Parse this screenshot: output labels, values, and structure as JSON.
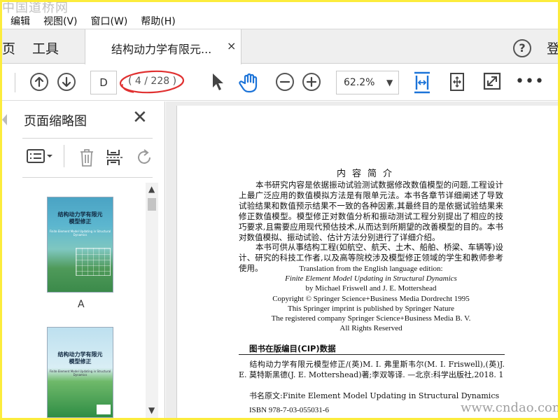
{
  "watermark_top": "中国道桥网",
  "watermark_bottom": "www.cndao.com",
  "menu": [
    "编辑",
    "视图(V)",
    "窗口(W)",
    "帮助(H)"
  ],
  "tabs": {
    "home_partial": "页",
    "tools": "工具",
    "doc": "结构动力学有限元...",
    "doc_close": "×"
  },
  "header": {
    "help": "?",
    "login_partial": "登"
  },
  "toolbar": {
    "page_input": "D",
    "page_count": "( 4 / 228 )",
    "zoom": "62.2%",
    "zoom_arrow": "▼",
    "more": "•••"
  },
  "thumb_panel": {
    "title": "页面缩略图",
    "close": "✕",
    "page_labels": [
      "A"
    ],
    "scroll_up": "▲",
    "scroll_down": "▼"
  },
  "thumbnails": {
    "cover_title": "结构动力学有限元\n模型修正",
    "cover_sub": "Finite Element Model Updating in Structural Dynamics"
  },
  "document": {
    "heading": "内容简介",
    "para1": "本书研究内容是依据振动试验测试数据修改数值模型的问题,工程设计上最广泛应用的数值模拟方法是有限单元法。本书各章节详细阐述了导致试验结果和数值预示结果不一致的各种因素,其最终目的是依据试验结果来修正数值模型。模型修正对数值分析和振动测试工程分别提出了相应的技巧要求,且需要应用现代预估技术,从而达到所期望的改善模型的目的。本书对数值模拟、振动试验、估计方法分别进行了详细介绍。",
    "para2": "本书可供从事结构工程(如航空、航天、土木、船舶、桥梁、车辆等)设计、研究的科技工作者,以及高等院校涉及模型修正领域的学生和教师参考使用。",
    "eng_lines": [
      "Translation from the English language edition:",
      "Finite Element Model Updating in Structural Dynamics",
      "by Michael Friswell and J. E. Mottershead",
      "Copyright © Springer Science+Business Media Dordrecht 1995",
      "This Springer imprint is published by Springer Nature",
      "The registered company Springer Science+Business Media B. V.",
      "All Rights Reserved"
    ],
    "cip_title": "图书在版编目(CIP)数据",
    "cip1": "结构动力学有限元模型修正/(英)M. I. 弗里斯韦尔(M. I. Friswell),(英)J. E. 莫特斯黑德(J. E. Mottershead)著;李双等译. —北京:科学出版社,2018. 1",
    "cip2": "书名原文:Finite Element Model Updating in Structural Dynamics",
    "cip3": "ISBN 978-7-03-055031-6"
  },
  "colors": {
    "frame": "#fcec3c",
    "annotation_circle": "#e03030",
    "accent_blue": "#1b73d8"
  }
}
